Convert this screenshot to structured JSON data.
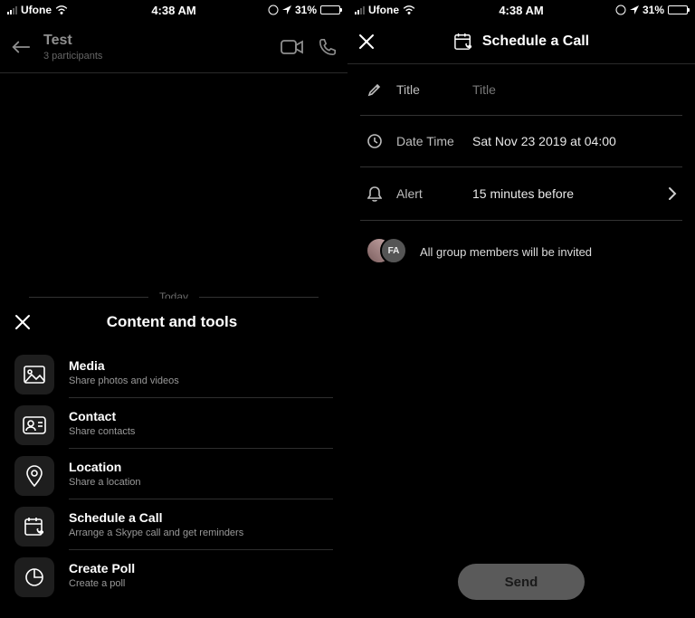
{
  "status": {
    "carrier": "Ufone",
    "time": "4:38 AM",
    "battery_pct": "31%"
  },
  "left": {
    "chat_title": "Test",
    "participants": "3 participants",
    "date_divider": "Today",
    "sheet_title": "Content and tools",
    "tools": [
      {
        "title": "Media",
        "desc": "Share photos and videos"
      },
      {
        "title": "Contact",
        "desc": "Share contacts"
      },
      {
        "title": "Location",
        "desc": "Share a location"
      },
      {
        "title": "Schedule a Call",
        "desc": "Arrange a Skype call and get reminders"
      },
      {
        "title": "Create Poll",
        "desc": "Create a poll"
      }
    ]
  },
  "right": {
    "header": "Schedule a Call",
    "title_label": "Title",
    "title_placeholder": "Title",
    "datetime_label": "Date Time",
    "datetime_value": "Sat Nov 23 2019 at 04:00",
    "alert_label": "Alert",
    "alert_value": "15 minutes before",
    "avatar_initials": "FA",
    "members_note": "All group members will be invited",
    "send_label": "Send"
  }
}
